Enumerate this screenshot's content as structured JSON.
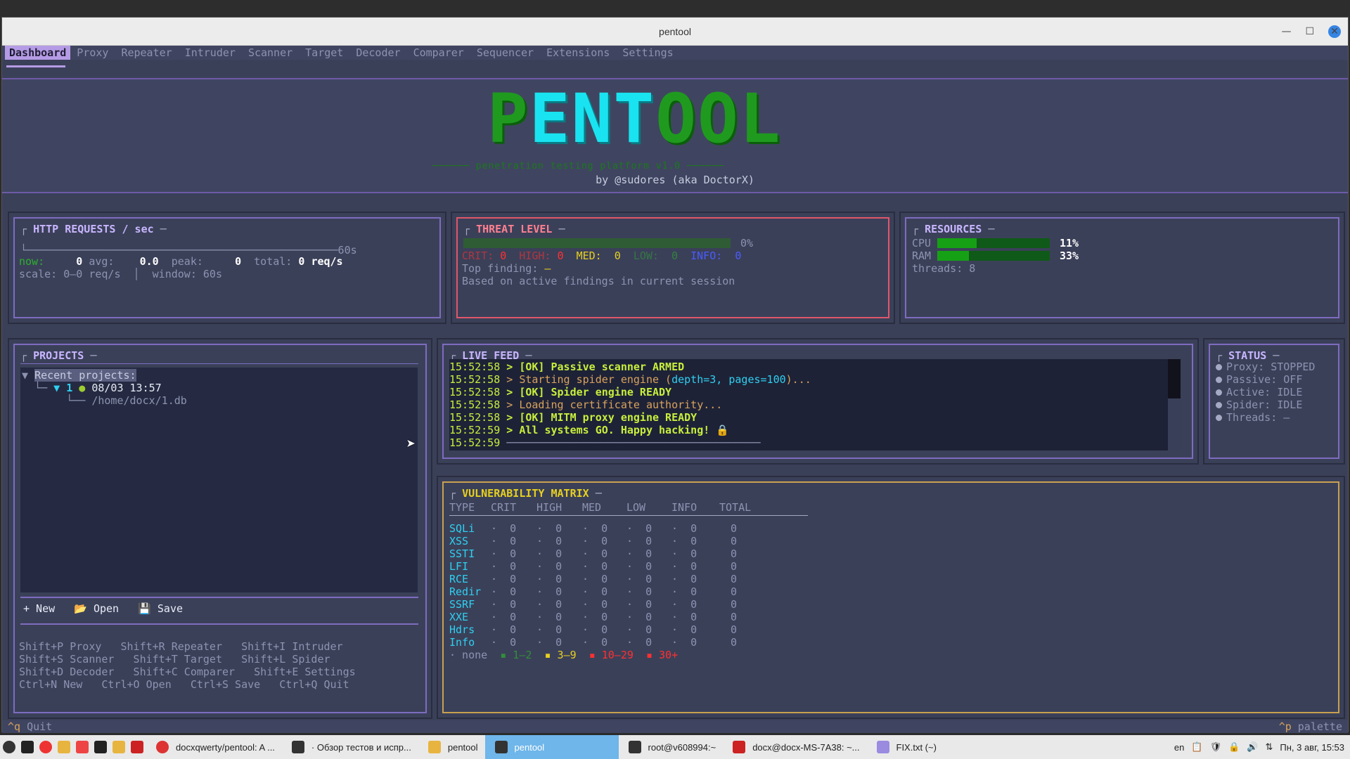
{
  "window": {
    "title": "pentool"
  },
  "menu": {
    "tabs": [
      "Dashboard",
      "Proxy",
      "Repeater",
      "Intruder",
      "Scanner",
      "Target",
      "Decoder",
      "Comparer",
      "Sequencer",
      "Extensions",
      "Settings"
    ]
  },
  "banner": {
    "logo": "PENTOOL",
    "subtitle": "────── penetration testing platform v1.0 ──────",
    "byline": "by @sudores (aka DoctorX)"
  },
  "http": {
    "title": "HTTP REQUESTS / sec",
    "axis_label": "60s",
    "now_label": "now:",
    "now": "0",
    "avg_label": "avg:",
    "avg": "0.0",
    "peak_label": "peak:",
    "peak": "0",
    "total_label": "total:",
    "total": "0",
    "unit": "req/s",
    "scale": "scale: 0–0 req/s",
    "window": "window: 60s"
  },
  "threat": {
    "title": "THREAT LEVEL",
    "percent": "0%",
    "level": 0,
    "crit_label": "CRIT:",
    "crit": "0",
    "high_label": "HIGH:",
    "high": "0",
    "med_label": "MED:",
    "med": "0",
    "low_label": "LOW:",
    "low": "0",
    "info_label": "INFO:",
    "info": "0",
    "top_finding": "Top finding:",
    "top_value": "—",
    "note": "Based on active findings in current session"
  },
  "resources": {
    "title": "RESOURCES",
    "cpu_label": "CPU",
    "cpu": "11%",
    "cpu_level": 0.11,
    "ram_label": "RAM",
    "ram": "33%",
    "ram_level": 0.33,
    "threads": "threads: 8"
  },
  "projects": {
    "title": "PROJECTS",
    "recent": "Recent projects:",
    "item_num": "1",
    "item_date": "08/03 13:57",
    "item_path": "/home/docx/1.db",
    "new": "+ New",
    "open": "Open",
    "save": "Save",
    "shortcuts": [
      "Shift+P Proxy   Shift+R Repeater   Shift+I Intruder",
      "Shift+S Scanner   Shift+T Target   Shift+L Spider",
      "Shift+D Decoder   Shift+C Comparer   Shift+E Settings",
      "Ctrl+N New   Ctrl+O Open   Ctrl+S Save   Ctrl+Q Quit"
    ]
  },
  "feed": {
    "title": "LIVE FEED",
    "lines": [
      {
        "t": "15:52:58",
        "m": "> [OK] Passive scanner ARMED",
        "s": "lime"
      },
      {
        "t": "15:52:58",
        "m": "> Starting spider engine (",
        "s": "orange",
        "extra": "depth=3, pages=100",
        "tail": ")..."
      },
      {
        "t": "15:52:58",
        "m": "> [OK] Spider engine READY",
        "s": "lime"
      },
      {
        "t": "15:52:58",
        "m": "> Loading certificate authority...",
        "s": "orange"
      },
      {
        "t": "15:52:58",
        "m": "> [OK] MITM proxy engine READY",
        "s": "lime"
      },
      {
        "t": "15:52:59",
        "m": "> All systems GO. Happy hacking! 🔒",
        "s": "lime"
      },
      {
        "t": "15:52:59",
        "m": "",
        "s": "rule"
      }
    ]
  },
  "status": {
    "title": "STATUS",
    "items": [
      "Proxy: STOPPED",
      "Passive: OFF",
      "Active: IDLE",
      "Spider: IDLE",
      "Threads: —"
    ]
  },
  "vuln": {
    "title": "VULNERABILITY MATRIX",
    "headers": [
      "TYPE",
      "CRIT",
      "HIGH",
      "MED",
      "LOW",
      "INFO",
      "TOTAL"
    ],
    "rows": [
      "SQLi",
      "XSS",
      "SSTI",
      "LFI",
      "RCE",
      "Redir",
      "SSRF",
      "XXE",
      "Hdrs",
      "Info"
    ],
    "zero": "0",
    "legend": {
      "none": "· none",
      "l1": "▪ 1–2",
      "l2": "▪ 3–9",
      "l3": "▪ 10–29",
      "l4": "▪ 30+"
    }
  },
  "statusbar": {
    "quit": "Quit",
    "quit_key": "^q",
    "palette": "palette",
    "palette_key": "^p"
  },
  "taskbar": {
    "items": [
      "docxqwerty/pentool: A ...",
      "· Обзор тестов и испр...",
      "pentool",
      "pentool",
      "root@v608994:~",
      "docx@docx-MS-7A38: ~...",
      "FIX.txt (~)"
    ],
    "lang": "en",
    "clock": "Пн, 3 авг, 15:53"
  }
}
